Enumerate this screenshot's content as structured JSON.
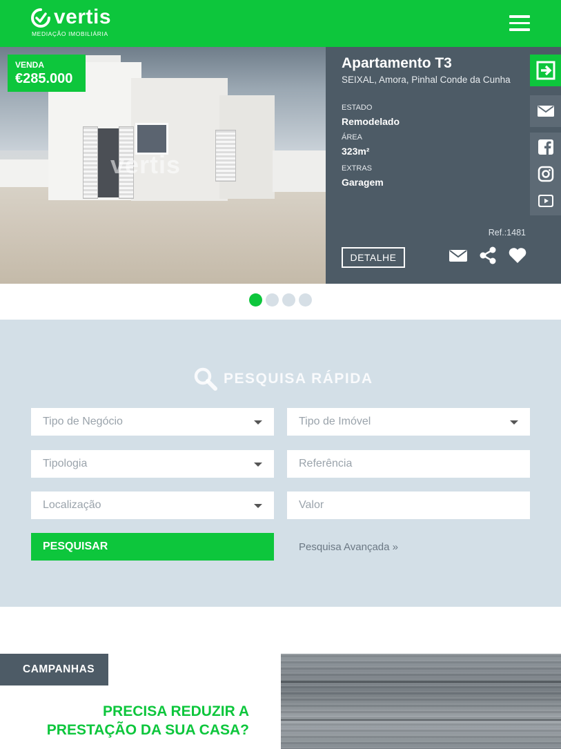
{
  "header": {
    "logo_name": "vertis",
    "logo_tagline": "MEDIAÇÃO IMOBILIÁRIA",
    "menu_icon": "hamburger-menu-icon",
    "brand_color": "#0dc63c"
  },
  "listing": {
    "badge_type": "VENDA",
    "price": "€285.000",
    "photo_watermark": "vertis",
    "title": "Apartamento T3",
    "location": "SEIXAL, Amora, Pinhal Conde da Cunha",
    "attributes": [
      {
        "label": "ESTADO",
        "value": "Remodelado"
      },
      {
        "label": "ÁREA",
        "value": "323m²"
      },
      {
        "label": "EXTRAS",
        "value": "Garagem"
      }
    ],
    "reference": "Ref.:1481",
    "detail_button": "DETALHE",
    "actions": [
      "envelope-icon",
      "share-icon",
      "heart-icon"
    ]
  },
  "side_rail": {
    "items": [
      "login-arrow-icon",
      "envelope-icon",
      "facebook-icon",
      "instagram-icon",
      "youtube-icon"
    ]
  },
  "carousel": {
    "slide_count": 4,
    "active_index": 0
  },
  "search": {
    "title": "PESQUISA RÁPIDA",
    "fields": {
      "tipo_negocio": "Tipo de Negócio",
      "tipo_imovel": "Tipo de Imóvel",
      "tipologia": "Tipologia",
      "referencia": "Referência",
      "localizacao": "Localização",
      "valor": "Valor"
    },
    "submit_label": "PESQUISAR",
    "advanced_link": "Pesquisa Avançada »"
  },
  "campaigns": {
    "tag": "CAMPANHAS",
    "headline_line1": "PRECISA REDUZIR A",
    "headline_line2": "PRESTAÇÃO DA SUA CASA?"
  }
}
